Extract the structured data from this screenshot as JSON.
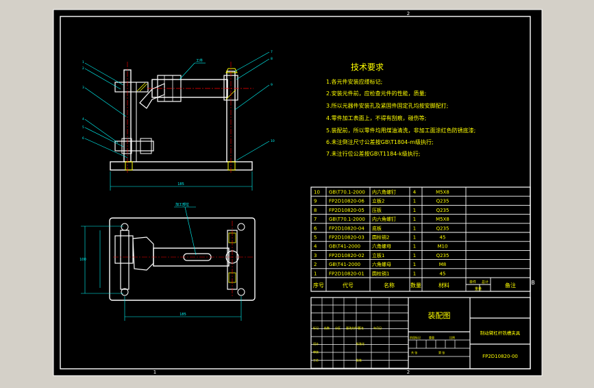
{
  "colors": {
    "page_bg": "#d4d0c8",
    "sheet_bg": "#000000",
    "outline": "#ffffff",
    "title_text": "#ffff00",
    "dimension": "#00ffff",
    "centerline": "#ff0000",
    "table_text": "#ffff00"
  },
  "zone_markers": {
    "top": "2",
    "bottom_left": "1",
    "bottom_mid": "2",
    "right": "B"
  },
  "views": {
    "front_callout": "工件",
    "top_callout": "加工部位",
    "front_dim_width": "185",
    "top_dim_width": "185",
    "top_dim_height": "100",
    "front_leader_numbers": [
      "1",
      "2",
      "3",
      "4",
      "5",
      "6",
      "7",
      "8",
      "9",
      "10"
    ]
  },
  "notes": {
    "title": "技术要求",
    "items": [
      "1.各元件安装应缕标记;",
      "2.安装元件前，应检查元件的性能，质量;",
      "3.所以元器件安装孔及紧固件固定孔均按安脚配打;",
      "4.零件加工表面上，不得有刮痕，碰伤等;",
      "5.装配前，所以零件均用煤油清洗，非加工面涂红色防锈底漆;",
      "6.未注倒注尺寸公差按GB\\T1804-m级执行;",
      "7.未注行位公差按GB\\T1184-k级执行;"
    ]
  },
  "bom": {
    "rows": [
      {
        "no": "10",
        "code": "GB\\T70.1-2000",
        "name": "内六角螺钉",
        "qty": "4",
        "material": "M5X8"
      },
      {
        "no": "9",
        "code": "FP2D10820-06",
        "name": "立板2",
        "qty": "1",
        "material": "Q235"
      },
      {
        "no": "8",
        "code": "FP2D10820-05",
        "name": "压板",
        "qty": "1",
        "material": "Q235"
      },
      {
        "no": "7",
        "code": "GB\\T70.1-2000",
        "name": "内六角螺钉",
        "qty": "1",
        "material": "M5X8"
      },
      {
        "no": "6",
        "code": "FP2D10820-04",
        "name": "底板",
        "qty": "1",
        "material": "Q235"
      },
      {
        "no": "5",
        "code": "FP2D10820-03",
        "name": "圆柱销2",
        "qty": "1",
        "material": "45"
      },
      {
        "no": "4",
        "code": "GB\\T41-2000",
        "name": "六角螺母",
        "qty": "1",
        "material": "M10"
      },
      {
        "no": "3",
        "code": "FP2D10820-02",
        "name": "立板1",
        "qty": "1",
        "material": "Q235"
      },
      {
        "no": "2",
        "code": "GB\\T41-2000",
        "name": "六角螺母",
        "qty": "1",
        "material": "M8"
      },
      {
        "no": "1",
        "code": "FP2D10820-01",
        "name": "圆柱销1",
        "qty": "1",
        "material": "45"
      }
    ],
    "header": {
      "no": "序号",
      "code": "代号",
      "name": "名称",
      "qty": "数量",
      "material": "材料",
      "single": "单件",
      "total": "总计",
      "weight": "重量",
      "remark": "备注"
    }
  },
  "title_block": {
    "drawing_name": "装配图",
    "product_name": "制动臂杠杆铣槽夹具",
    "drawing_no": "FP2D10820-00",
    "small_labels": [
      "标记",
      "处数",
      "分区",
      "更改文件号",
      "签名",
      "年月日",
      "设计",
      "标准化",
      "审核",
      "工艺",
      "批准",
      "阶段标记",
      "重量",
      "比例",
      "共 张",
      "第 张"
    ]
  }
}
